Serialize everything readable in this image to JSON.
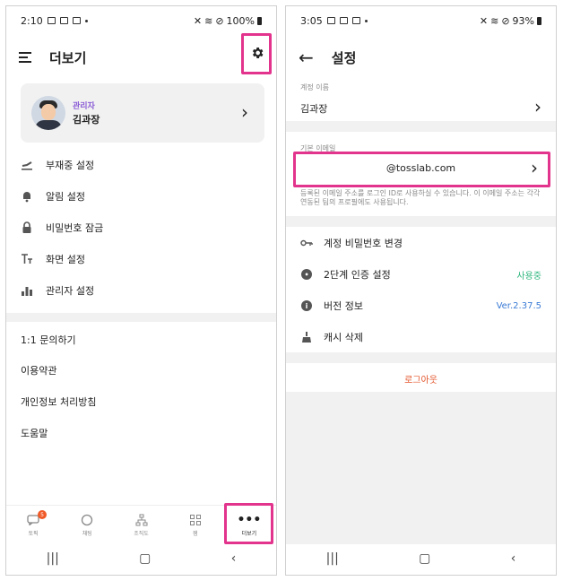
{
  "left": {
    "status": {
      "time": "2:10",
      "battery": "100%"
    },
    "header": {
      "title": "더보기",
      "menu_icon": "hamburger-icon",
      "settings_icon": "gear-icon"
    },
    "profile": {
      "role": "관리자",
      "name": "김과장"
    },
    "menu": [
      {
        "label": "부재중 설정",
        "icon": "away-icon"
      },
      {
        "label": "알림 설정",
        "icon": "bell-icon"
      },
      {
        "label": "비밀번호 잠금",
        "icon": "lock-icon"
      },
      {
        "label": "화면 설정",
        "icon": "text-size-icon"
      },
      {
        "label": "관리자 설정",
        "icon": "bar-chart-icon"
      }
    ],
    "links": [
      "1:1 문의하기",
      "이용약관",
      "개인정보 처리방침",
      "도움말"
    ],
    "bottom_nav": [
      {
        "label": "토픽",
        "icon": "topic-icon",
        "badge": "5"
      },
      {
        "label": "채팅",
        "icon": "chat-icon"
      },
      {
        "label": "조직도",
        "icon": "org-chart-icon"
      },
      {
        "label": "잼",
        "icon": "grid-icon"
      },
      {
        "label": "더보기",
        "icon": "more-icon"
      }
    ],
    "highlight_color": "#e3348d"
  },
  "right": {
    "status": {
      "time": "3:05",
      "battery": "93%"
    },
    "header": {
      "title": "설정",
      "back_icon": "back-arrow-icon"
    },
    "account_name": {
      "label": "계정 이름",
      "value": "김과장"
    },
    "email": {
      "label": "기본 이메일",
      "value": "@tosslab.com",
      "note": "등록된 이메일 주소를 로그인 ID로 사용하실 수 있습니다. 이 이메일 주소는 각각 연동된 팀의 프로필에도 사용됩니다."
    },
    "settings": [
      {
        "label": "계정 비밀번호 변경",
        "icon": "key-icon",
        "value": ""
      },
      {
        "label": "2단계 인증 설정",
        "icon": "shield-lock-icon",
        "value": "사용중",
        "value_color": "#2eb67d"
      },
      {
        "label": "버전 정보",
        "icon": "info-icon",
        "value": "Ver.2.37.5",
        "value_color": "#3a7bd5"
      },
      {
        "label": "캐시 삭제",
        "icon": "broom-icon",
        "value": ""
      }
    ],
    "logout": "로그아웃",
    "logout_color": "#e4572e"
  }
}
